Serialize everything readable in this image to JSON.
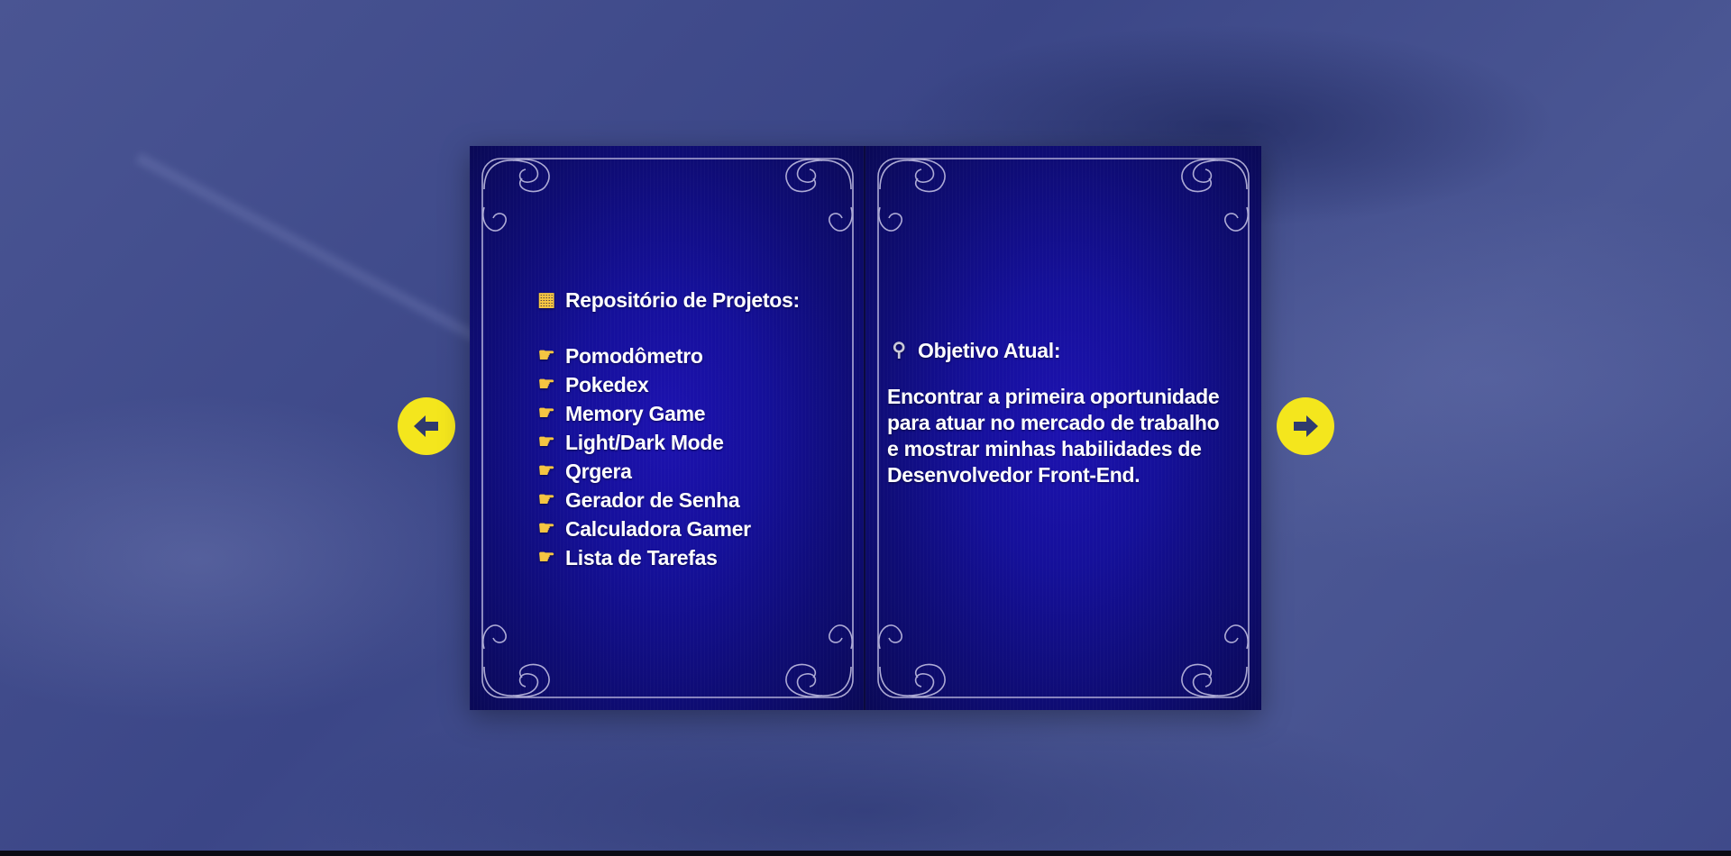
{
  "left_page": {
    "heading_icon": "abacus-icon",
    "heading": "Repositório de Projetos:",
    "item_icon": "pointing-right-hand-icon",
    "projects": [
      "Pomodômetro",
      "Pokedex",
      "Memory Game",
      "Light/Dark Mode",
      "Qrgera",
      "Gerador de Senha",
      "Calculadora Gamer",
      "Lista de Tarefas"
    ]
  },
  "right_page": {
    "heading_icon": "telescope-icon",
    "heading": "Objetivo Atual:",
    "lines": [
      "Encontrar a primeira oportunidade",
      "para atuar no mercado de trabalho",
      "e mostrar minhas habilidades de",
      "Desenvolvedor Front-End."
    ]
  },
  "nav": {
    "prev_icon": "arrow-left-icon",
    "next_icon": "arrow-right-icon",
    "accent_color": "#f4e61d"
  },
  "colors": {
    "background": "#3f4a8a",
    "page": "#15109a",
    "text": "#ffffff"
  }
}
